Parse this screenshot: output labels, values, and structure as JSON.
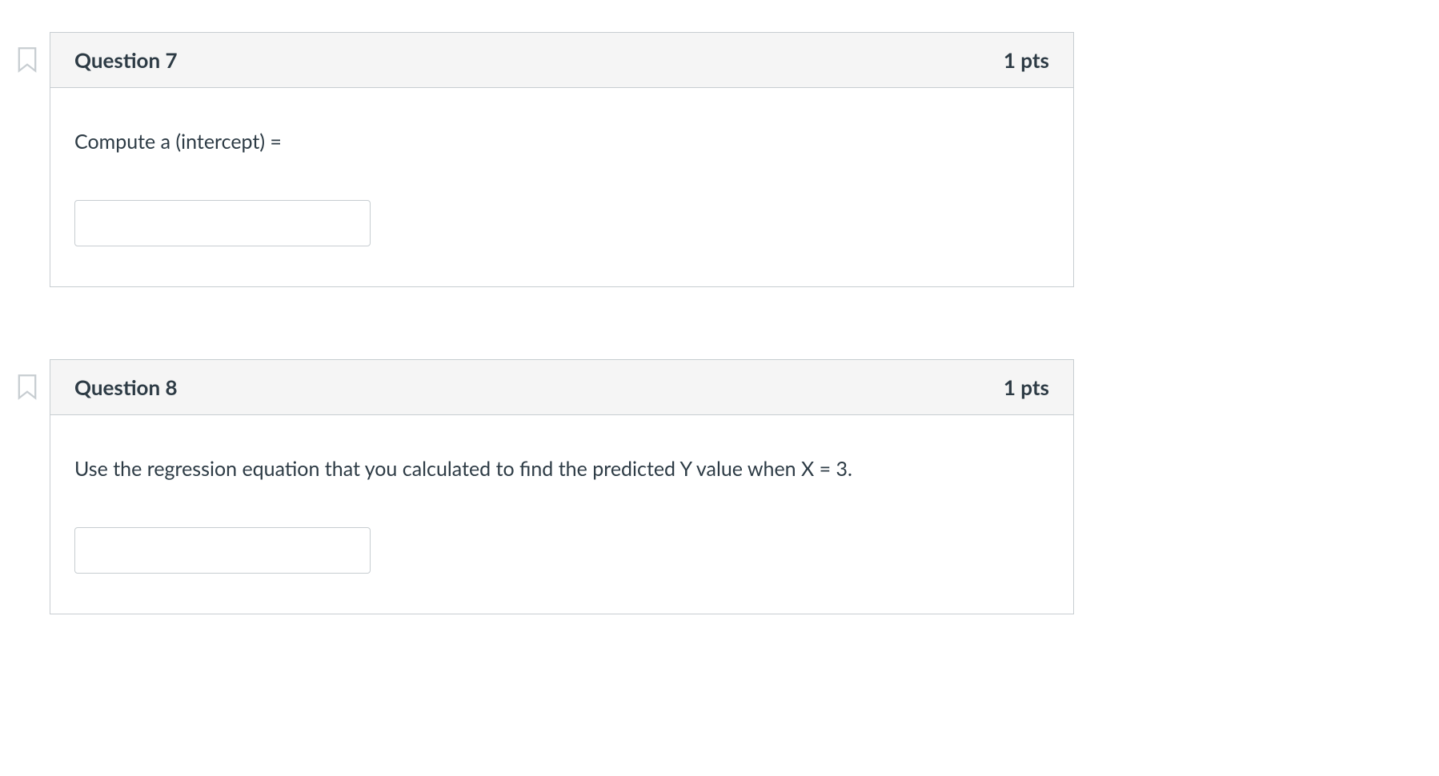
{
  "questions": [
    {
      "title": "Question 7",
      "points": "1 pts",
      "prompt": "Compute a (intercept) =",
      "answer": ""
    },
    {
      "title": "Question 8",
      "points": "1 pts",
      "prompt": "Use the regression equation that you calculated to find the predicted Y value when X = 3.",
      "answer": ""
    }
  ]
}
